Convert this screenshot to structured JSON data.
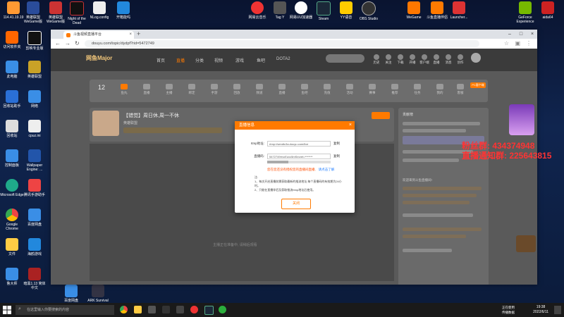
{
  "desktop": {
    "icons_top": [
      {
        "label": "114.41.19.19",
        "color": "#ff9933"
      },
      {
        "label": "英雄联盟 WeGame版",
        "color": "#2a4c9a"
      },
      {
        "label": "英雄联盟 WeGame版",
        "color": "#c33"
      },
      {
        "label": "Night of the Dead",
        "color": "#111"
      },
      {
        "label": "NLog.config",
        "color": "#eee"
      },
      {
        "label": "开箱能吗",
        "color": "#2288dd"
      },
      {
        "label": "网易云音乐",
        "color": "#e33"
      },
      {
        "label": "Tag Y",
        "color": "#555"
      },
      {
        "label": "网易UU加速器",
        "color": "#fff"
      },
      {
        "label": "Steam",
        "color": "#1b2838"
      },
      {
        "label": "YY语音",
        "color": "#ffcc00"
      },
      {
        "label": "OBS Studio",
        "color": "#333"
      },
      {
        "label": "WeGame",
        "color": "#ff7700"
      },
      {
        "label": "斗鱼直播伴侣",
        "color": "#ff7a00"
      },
      {
        "label": "Launcher...",
        "color": "#d33"
      },
      {
        "label": "GeForce Experience",
        "color": "#76b900"
      },
      {
        "label": "aida64",
        "color": "#c22"
      }
    ],
    "icons_left": [
      {
        "label": "访问软件夹",
        "color": "#ff6600"
      },
      {
        "label": "剪映专业版",
        "color": "#111"
      },
      {
        "label": "此电脑",
        "color": "#3a8ee6"
      },
      {
        "label": "英雄联盟",
        "color": "#c9a227"
      },
      {
        "label": "回收站助手",
        "color": "#2a6fd6"
      },
      {
        "label": "网络",
        "color": "#3a8ee6"
      },
      {
        "label": "回收站",
        "color": "#ddd"
      },
      {
        "label": "cpuz.ini",
        "color": "#eee"
      },
      {
        "label": "控制面板",
        "color": "#3a8ee6"
      },
      {
        "label": "Wallpaper Engine: ...",
        "color": "#2255aa"
      },
      {
        "label": "Microsoft Edge",
        "color": "#1faa8a"
      },
      {
        "label": "腾讯手游助手",
        "color": "#e44"
      },
      {
        "label": "Google Chrome",
        "color": "#e44"
      },
      {
        "label": "百度网盘",
        "color": "#3a8ee6"
      },
      {
        "label": "文件",
        "color": "#ffcc44"
      },
      {
        "label": "海鸥游戏",
        "color": "#2288dd"
      },
      {
        "label": "鲁大师",
        "color": "#3a8ee6"
      },
      {
        "label": "暗黑1.13 简体中文",
        "color": "#a22"
      },
      {
        "label": "百度网盘",
        "color": "#3a8ee6"
      },
      {
        "label": "ARK Survival Evolved",
        "color": "#334"
      }
    ]
  },
  "browser": {
    "tab_title": "斗鱼视频直播平台",
    "url": "douyu.com/topic/dydpf?rid=5472749",
    "new_tab": "+",
    "win_min": "–",
    "win_max": "□",
    "win_close": "×"
  },
  "site": {
    "logo": "网鱼Major",
    "nav": [
      "首页",
      "直播",
      "分类",
      "视频",
      "游戏",
      "鱼吧",
      "DOTA2"
    ],
    "right_icons": [
      "历史",
      "关注",
      "下载",
      "开播",
      "客户端",
      "直播",
      "消息",
      "创作"
    ],
    "categories": [
      "12",
      "鱼丸",
      "直播",
      "主播",
      "绑定",
      "手游",
      "回放",
      "频道",
      "直播",
      "鱼吧",
      "充值",
      "活动",
      "赛事",
      "推荐",
      "任务",
      "我的",
      "客服",
      "PC客户端"
    ],
    "room_title": "【错觉】周日休,周一不休",
    "room_subtitle": "英雄联盟",
    "player_placeholder": "主播正在准备中, 请稍后观看",
    "right_panel_title": "贡献榜",
    "right_panel_chat": "欢迎来到斗鱼直播间!"
  },
  "modal": {
    "title": "直播信息",
    "close": "×",
    "rtmp_label": "rtmp地址:",
    "rtmp_value": "rtmp://sendtc3a.douyu.com/live",
    "rtmp_copy": "复制",
    "code_label": "直播码:",
    "code_value": "5472749rrvcEuvc5mSecret=*******",
    "code_copy": "复制",
    "warning": "您在您还没有授权您的直播间直播,",
    "warning_link": "请点击了解",
    "notes_title": "注:",
    "note1": "1、每次开启直播前需获取最新的推流地址,每个直播码的有效期为24小时。",
    "note2": "2、只能在直播伴侣及获取推流rtmp地址后使用。",
    "ok": "关闭"
  },
  "overlay": {
    "fans_group": "粉丝群: 434374948",
    "notice": "直播通知群: 225643815"
  },
  "taskbar": {
    "search_placeholder": "在这里输入你要搜索的内容",
    "time": "19:38",
    "date": "2022/6/11",
    "ime_top": "正在使用",
    "ime_bottom": "传播数据"
  }
}
